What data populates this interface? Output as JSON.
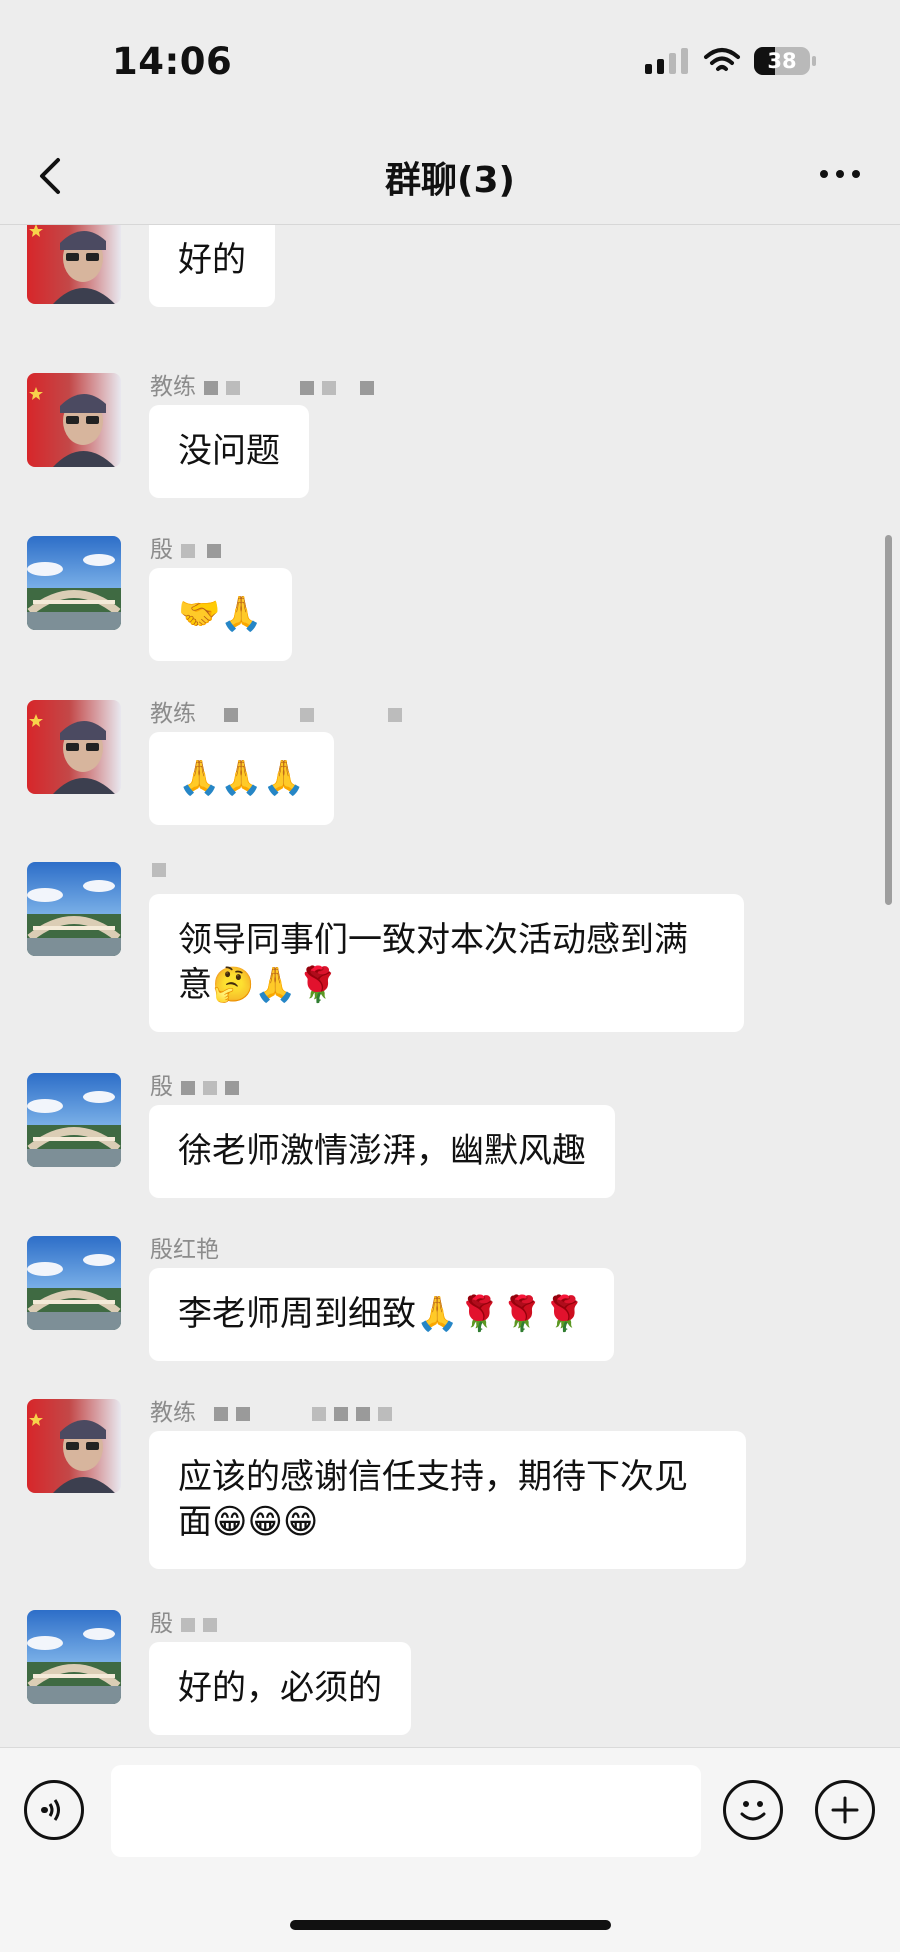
{
  "status_bar": {
    "time": "14:06",
    "battery_percent": "38",
    "signal_icon": "cellular-signal-icon",
    "wifi_icon": "wifi-icon"
  },
  "nav": {
    "title": "群聊(3)",
    "back_icon": "chevron-left-icon",
    "more_icon": "more-dots-icon"
  },
  "messages": [
    {
      "sender": "",
      "avatar": "coach",
      "text": "好的"
    },
    {
      "sender": "教练",
      "avatar": "bridge-coach",
      "text": "没问题"
    },
    {
      "sender": "殷",
      "avatar": "bridge",
      "text": "🤝🙏"
    },
    {
      "sender": "教练",
      "avatar": "coach",
      "text": "🙏🙏🙏"
    },
    {
      "sender": "",
      "avatar": "bridge",
      "text": "领导同事们一致对本次活动感到满意🤔🙏🌹"
    },
    {
      "sender": "殷",
      "avatar": "bridge",
      "text": "徐老师激情澎湃，幽默风趣"
    },
    {
      "sender": "殷红艳",
      "avatar": "bridge",
      "text": "李老师周到细致🙏🌹🌹🌹"
    },
    {
      "sender": "教练",
      "avatar": "coach",
      "text": "应该的感谢信任支持，期待下次见面😁😁😁"
    },
    {
      "sender": "殷",
      "avatar": "bridge",
      "text": "好的，必须的"
    }
  ],
  "input_bar": {
    "voice_icon": "voice-icon",
    "emoji_icon": "emoji-icon",
    "plus_icon": "plus-icon",
    "placeholder": ""
  }
}
